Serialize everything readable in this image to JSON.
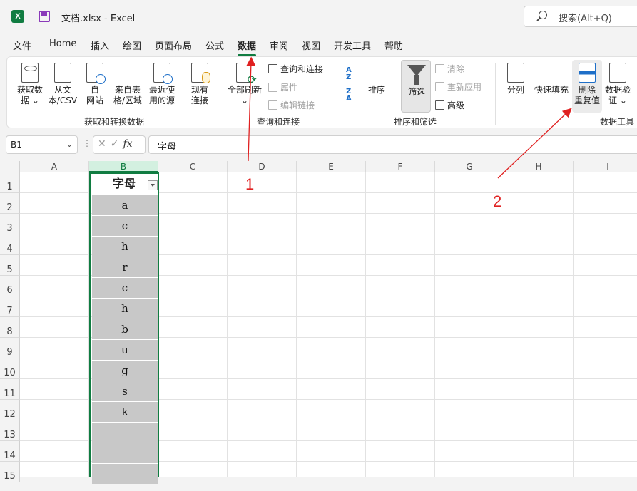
{
  "window": {
    "title": "文档.xlsx  -  Excel",
    "logo_letter": "X",
    "search_placeholder": "搜索(Alt+Q)"
  },
  "tabs": [
    "文件",
    "Home",
    "插入",
    "绘图",
    "页面布局",
    "公式",
    "数据",
    "审阅",
    "视图",
    "开发工具",
    "帮助"
  ],
  "active_tab": "数据",
  "ribbon": {
    "get_data": {
      "l1": "获取数",
      "l2": "据 ⌄"
    },
    "from_text": {
      "l1": "从文",
      "l2": "本/CSV"
    },
    "from_web": {
      "l1": "自",
      "l2": "网站"
    },
    "from_table": {
      "l1": "来自表",
      "l2": "格/区域"
    },
    "recent_sources": {
      "l1": "最近使",
      "l2": "用的源"
    },
    "existing_conn": {
      "l1": "现有",
      "l2": "连接"
    },
    "group1_label": "获取和转换数据",
    "refresh_all": {
      "l1": "全部刷新",
      "l2": "⌄"
    },
    "queries_connections": "查询和连接",
    "properties": "属性",
    "edit_links": "编辑链接",
    "group2_label": "查询和连接",
    "sort_asc": "A\nZ",
    "sort_desc": "Z\nA",
    "sort": "排序",
    "filter": "筛选",
    "clear": "清除",
    "reapply": "重新应用",
    "advanced": "高级",
    "group3_label": "排序和筛选",
    "text_to_columns": "分列",
    "flash_fill": "快速填充",
    "remove_duplicates": {
      "l1": "删除",
      "l2": "重复值"
    },
    "data_validation": {
      "l1": "数据验",
      "l2": "证 ⌄"
    },
    "group4_label": "数据工具"
  },
  "formula_bar": {
    "name_box": "B1",
    "formula": "字母",
    "fx": "fx"
  },
  "columns": [
    "A",
    "B",
    "C",
    "D",
    "E",
    "F",
    "G",
    "H",
    "I"
  ],
  "selected_column": "B",
  "rows": [
    "1",
    "2",
    "3",
    "4",
    "5",
    "6",
    "7",
    "8",
    "9",
    "10",
    "11",
    "12",
    "13",
    "14",
    "15"
  ],
  "column_b": {
    "header": "字母",
    "values": [
      "a",
      "c",
      "h",
      "r",
      "c",
      "h",
      "b",
      "u",
      "g",
      "s",
      "k"
    ]
  },
  "annotations": {
    "label1": "1",
    "label2": "2",
    "color": "#e02020"
  }
}
